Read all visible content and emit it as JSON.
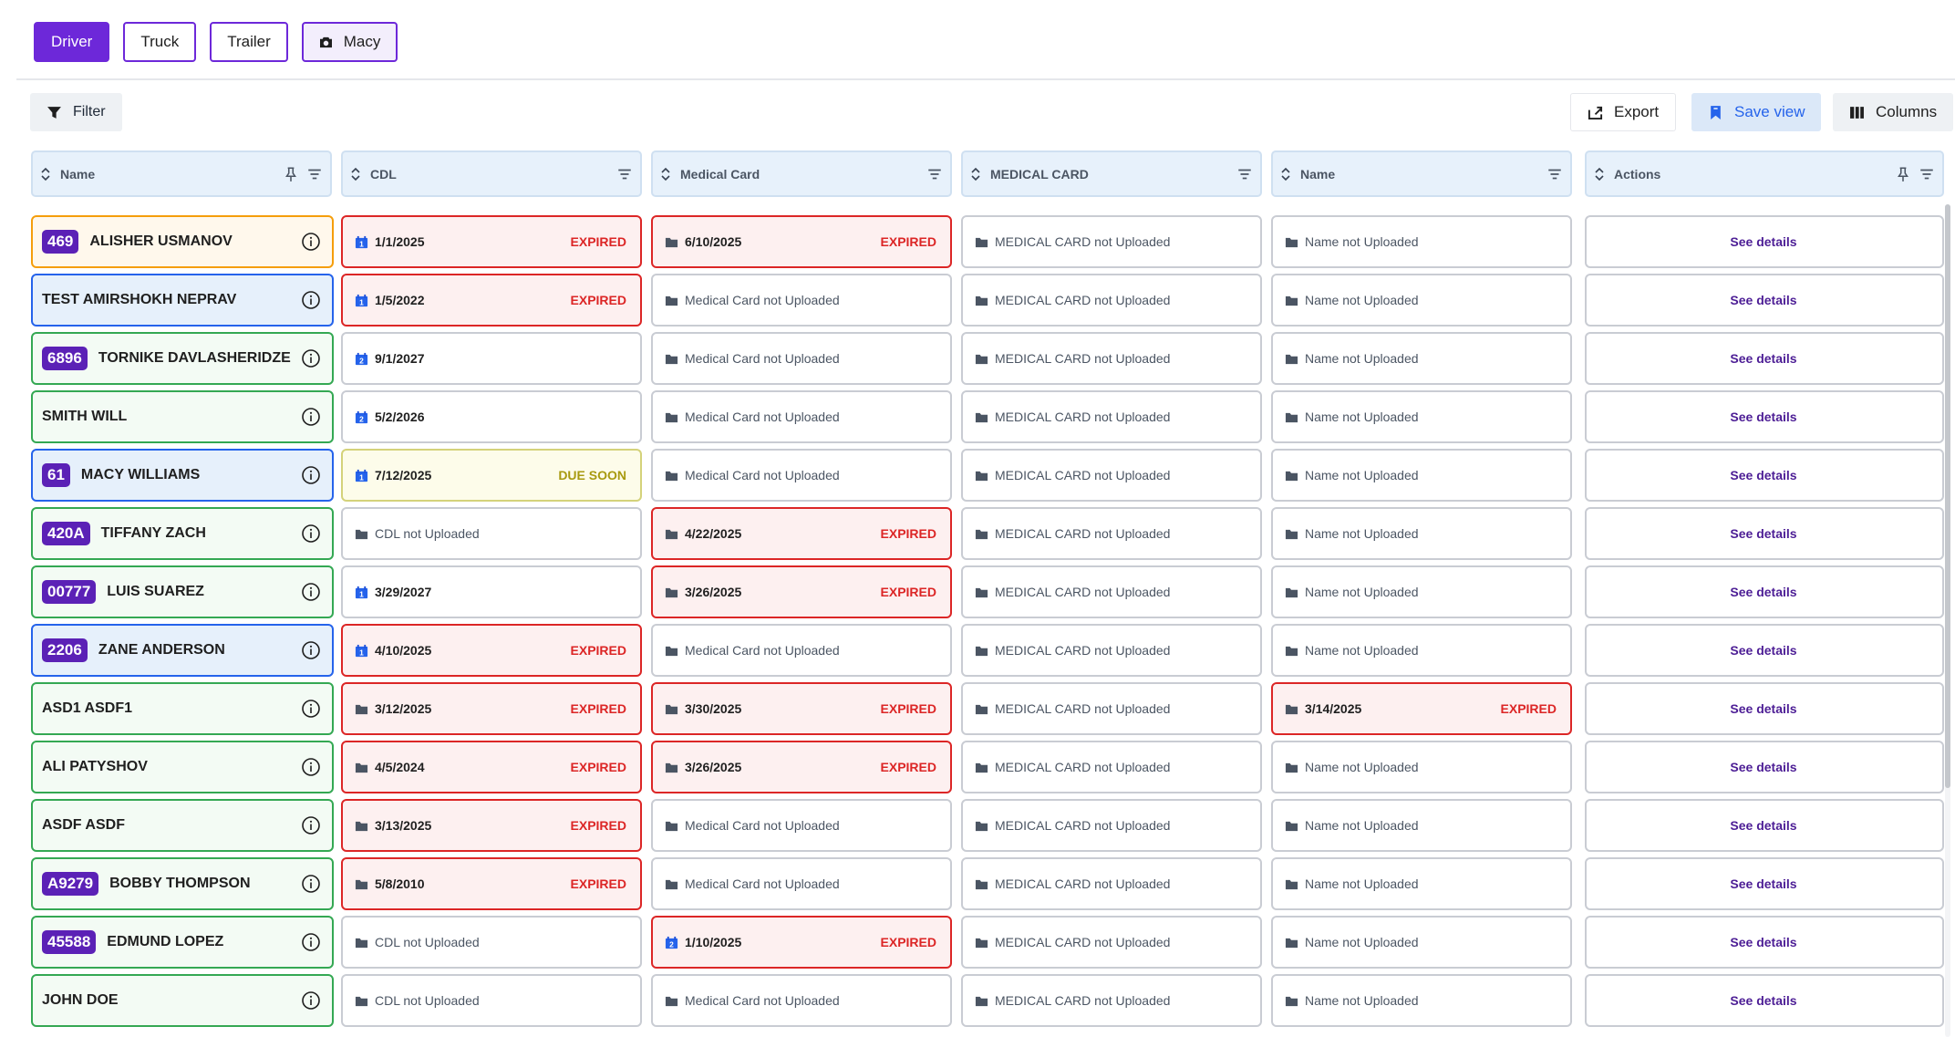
{
  "tabs": [
    {
      "label": "Driver",
      "active": true
    },
    {
      "label": "Truck",
      "active": false
    },
    {
      "label": "Trailer",
      "active": false
    },
    {
      "label": "Macy",
      "active": false
    }
  ],
  "toolbar": {
    "filter_label": "Filter",
    "export_label": "Export",
    "save_view_label": "Save view",
    "columns_label": "Columns"
  },
  "columns": [
    {
      "label": "Name"
    },
    {
      "label": "CDL"
    },
    {
      "label": "Medical Card"
    },
    {
      "label": "MEDICAL CARD"
    },
    {
      "label": "Name"
    },
    {
      "label": "Actions"
    }
  ],
  "action_label": "See details",
  "colors": {
    "accent": "#6d28d9",
    "expired": "#dc2626",
    "due_soon": "#a89a10",
    "active_border": "#34a853",
    "pinned_border": "#2563eb",
    "highlight_border": "#f59e0b"
  },
  "rows": [
    {
      "badge": "469",
      "name": "ALISHER USMANOV",
      "style": "orange",
      "cells": [
        {
          "type": "doc",
          "value": "1/1/2025",
          "count": "1",
          "status": "EXPIRED"
        },
        {
          "type": "doc",
          "value": "6/10/2025",
          "status": "EXPIRED"
        },
        {
          "type": "missing",
          "value": "MEDICAL CARD not Uploaded"
        },
        {
          "type": "missing",
          "value": "Name not Uploaded"
        }
      ]
    },
    {
      "badge": "",
      "name": "TEST AMIRSHOKH NEPRAV",
      "style": "blue",
      "cells": [
        {
          "type": "doc",
          "value": "1/5/2022",
          "count": "1",
          "status": "EXPIRED"
        },
        {
          "type": "missing",
          "value": "Medical Card not Uploaded"
        },
        {
          "type": "missing",
          "value": "MEDICAL CARD not Uploaded"
        },
        {
          "type": "missing",
          "value": "Name not Uploaded"
        }
      ]
    },
    {
      "badge": "6896",
      "name": "TORNIKE DAVLASHERIDZE",
      "style": "green",
      "cells": [
        {
          "type": "doc",
          "value": "9/1/2027",
          "count": "2",
          "status": ""
        },
        {
          "type": "missing",
          "value": "Medical Card not Uploaded"
        },
        {
          "type": "missing",
          "value": "MEDICAL CARD not Uploaded"
        },
        {
          "type": "missing",
          "value": "Name not Uploaded"
        }
      ]
    },
    {
      "badge": "",
      "name": "SMITH WILL",
      "style": "green",
      "cells": [
        {
          "type": "doc",
          "value": "5/2/2026",
          "count": "2",
          "status": ""
        },
        {
          "type": "missing",
          "value": "Medical Card not Uploaded"
        },
        {
          "type": "missing",
          "value": "MEDICAL CARD not Uploaded"
        },
        {
          "type": "missing",
          "value": "Name not Uploaded"
        }
      ]
    },
    {
      "badge": "61",
      "name": "MACY WILLIAMS",
      "style": "blue",
      "cells": [
        {
          "type": "doc",
          "value": "7/12/2025",
          "count": "1",
          "status": "DUE SOON"
        },
        {
          "type": "missing",
          "value": "Medical Card not Uploaded"
        },
        {
          "type": "missing",
          "value": "MEDICAL CARD not Uploaded"
        },
        {
          "type": "missing",
          "value": "Name not Uploaded"
        }
      ]
    },
    {
      "badge": "420A",
      "name": "TIFFANY ZACH",
      "style": "green",
      "cells": [
        {
          "type": "missing",
          "value": "CDL not Uploaded"
        },
        {
          "type": "doc",
          "value": "4/22/2025",
          "status": "EXPIRED"
        },
        {
          "type": "missing",
          "value": "MEDICAL CARD not Uploaded"
        },
        {
          "type": "missing",
          "value": "Name not Uploaded"
        }
      ]
    },
    {
      "badge": "00777",
      "name": "LUIS SUAREZ",
      "style": "green",
      "cells": [
        {
          "type": "doc",
          "value": "3/29/2027",
          "count": "1",
          "status": ""
        },
        {
          "type": "doc",
          "value": "3/26/2025",
          "status": "EXPIRED"
        },
        {
          "type": "missing",
          "value": "MEDICAL CARD not Uploaded"
        },
        {
          "type": "missing",
          "value": "Name not Uploaded"
        }
      ]
    },
    {
      "badge": "2206",
      "name": "ZANE ANDERSON",
      "style": "blue",
      "cells": [
        {
          "type": "doc",
          "value": "4/10/2025",
          "count": "1",
          "status": "EXPIRED"
        },
        {
          "type": "missing",
          "value": "Medical Card not Uploaded"
        },
        {
          "type": "missing",
          "value": "MEDICAL CARD not Uploaded"
        },
        {
          "type": "missing",
          "value": "Name not Uploaded"
        }
      ]
    },
    {
      "badge": "",
      "name": "ASD1 ASDF1",
      "style": "green",
      "cells": [
        {
          "type": "doc",
          "value": "3/12/2025",
          "status": "EXPIRED"
        },
        {
          "type": "doc",
          "value": "3/30/2025",
          "status": "EXPIRED"
        },
        {
          "type": "missing",
          "value": "MEDICAL CARD not Uploaded"
        },
        {
          "type": "doc",
          "value": "3/14/2025",
          "status": "EXPIRED"
        }
      ]
    },
    {
      "badge": "",
      "name": "ALI PATYSHOV",
      "style": "green",
      "cells": [
        {
          "type": "doc",
          "value": "4/5/2024",
          "status": "EXPIRED"
        },
        {
          "type": "doc",
          "value": "3/26/2025",
          "status": "EXPIRED"
        },
        {
          "type": "missing",
          "value": "MEDICAL CARD not Uploaded"
        },
        {
          "type": "missing",
          "value": "Name not Uploaded"
        }
      ]
    },
    {
      "badge": "",
      "name": "ASDF ASDF",
      "style": "green",
      "cells": [
        {
          "type": "doc",
          "value": "3/13/2025",
          "status": "EXPIRED"
        },
        {
          "type": "missing",
          "value": "Medical Card not Uploaded"
        },
        {
          "type": "missing",
          "value": "MEDICAL CARD not Uploaded"
        },
        {
          "type": "missing",
          "value": "Name not Uploaded"
        }
      ]
    },
    {
      "badge": "A9279",
      "name": "BOBBY THOMPSON",
      "style": "green",
      "cells": [
        {
          "type": "doc",
          "value": "5/8/2010",
          "status": "EXPIRED"
        },
        {
          "type": "missing",
          "value": "Medical Card not Uploaded"
        },
        {
          "type": "missing",
          "value": "MEDICAL CARD not Uploaded"
        },
        {
          "type": "missing",
          "value": "Name not Uploaded"
        }
      ]
    },
    {
      "badge": "45588",
      "name": "EDMUND LOPEZ",
      "style": "green",
      "cells": [
        {
          "type": "missing",
          "value": "CDL not Uploaded"
        },
        {
          "type": "doc",
          "value": "1/10/2025",
          "count": "2",
          "status": "EXPIRED"
        },
        {
          "type": "missing",
          "value": "MEDICAL CARD not Uploaded"
        },
        {
          "type": "missing",
          "value": "Name not Uploaded"
        }
      ]
    },
    {
      "badge": "",
      "name": "JOHN DOE",
      "style": "green",
      "cells": [
        {
          "type": "missing",
          "value": "CDL not Uploaded"
        },
        {
          "type": "missing",
          "value": "Medical Card not Uploaded"
        },
        {
          "type": "missing",
          "value": "MEDICAL CARD not Uploaded"
        },
        {
          "type": "missing",
          "value": "Name not Uploaded"
        }
      ]
    }
  ]
}
